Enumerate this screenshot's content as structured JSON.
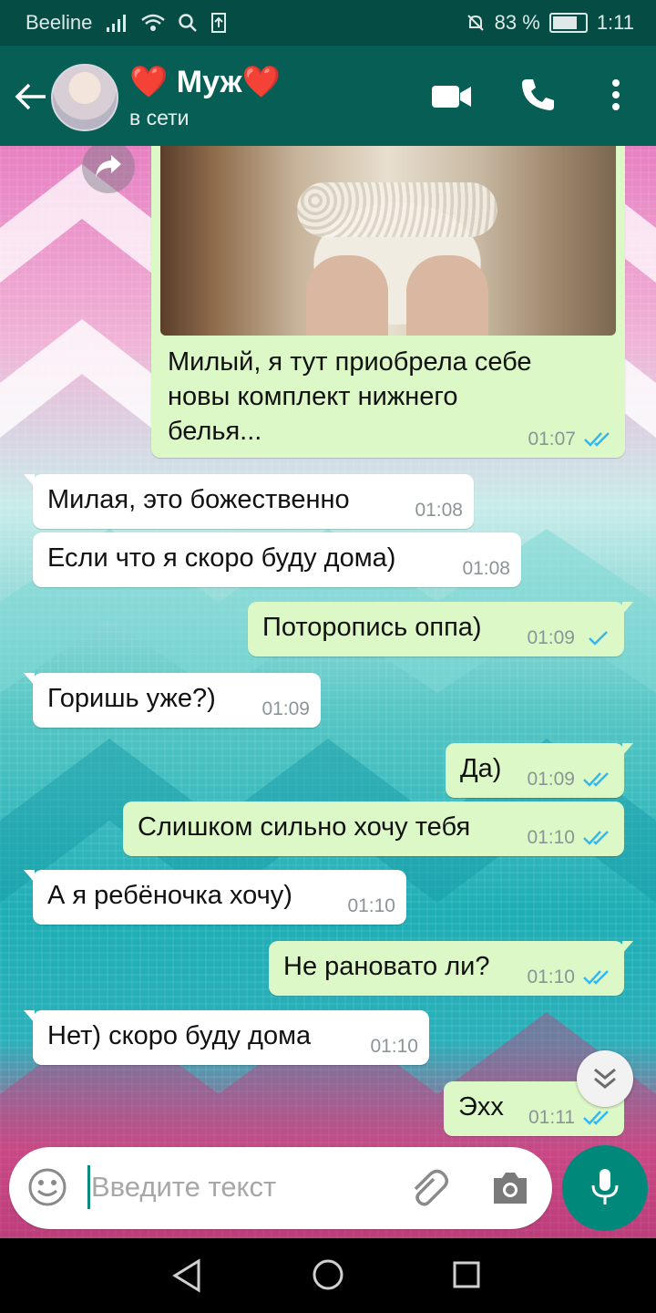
{
  "status_bar": {
    "carrier": "Beeline",
    "battery_percent": "83 %",
    "time": "1:11"
  },
  "app_bar": {
    "contact_name": "Муж",
    "heart_left": "❤️",
    "heart_right": "❤️",
    "status": "в сети"
  },
  "messages": [
    {
      "dir": "out",
      "type": "image",
      "text": "Милый, я тут приобрела себе новы комплект нижнего белья...",
      "lines": [
        "Милый, я тут приобрела себе",
        "новы комплект нижнего",
        "белья..."
      ],
      "time": "01:07",
      "ticks": "read"
    },
    {
      "dir": "in",
      "text": "Милая, это божественно",
      "time": "01:08"
    },
    {
      "dir": "in",
      "text": "Если что я скоро буду дома)",
      "time": "01:08"
    },
    {
      "dir": "out",
      "text": "Поторопись оппа)",
      "time": "01:09",
      "ticks": "sent"
    },
    {
      "dir": "in",
      "text": "Горишь уже?)",
      "time": "01:09"
    },
    {
      "dir": "out",
      "text": "Да)",
      "time": "01:09",
      "ticks": "read"
    },
    {
      "dir": "out",
      "text": "Слишком сильно хочу тебя",
      "time": "01:10",
      "ticks": "read"
    },
    {
      "dir": "in",
      "text": "А я ребёночка хочу)",
      "time": "01:10"
    },
    {
      "dir": "out",
      "text": "Не рановато ли?",
      "time": "01:10",
      "ticks": "read"
    },
    {
      "dir": "in",
      "text": "Нет) скоро буду дома",
      "time": "01:10"
    },
    {
      "dir": "out",
      "text": "Эхх",
      "time": "01:11",
      "ticks": "read"
    }
  ],
  "input": {
    "placeholder": "Введите текст"
  },
  "colors": {
    "header": "#075e54",
    "status_bar": "#054d44",
    "outgoing_bubble": "#dcf8c6",
    "incoming_bubble": "#ffffff",
    "read_tick": "#34b7f1",
    "accent": "#00897b"
  },
  "icons": [
    "back-arrow-icon",
    "video-call-icon",
    "phone-icon",
    "more-vert-icon",
    "forward-icon",
    "scroll-down-icon",
    "emoji-icon",
    "attach-icon",
    "camera-icon",
    "mic-icon",
    "nav-back-icon",
    "nav-home-icon",
    "nav-recent-icon"
  ]
}
